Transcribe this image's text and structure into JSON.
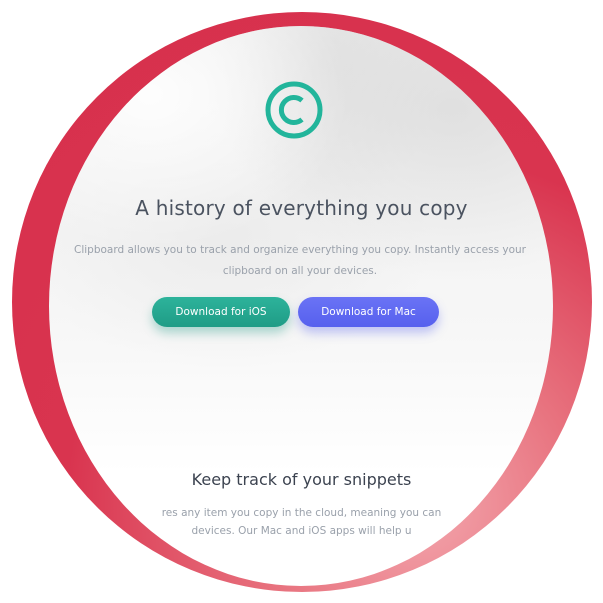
{
  "logo": {
    "icon": "copyright-c-icon",
    "color": "#22b59b"
  },
  "hero": {
    "headline": "A history of everything you copy",
    "subtext": "Clipboard allows you to track and organize everything you copy. Instantly access your clipboard on all your devices."
  },
  "buttons": {
    "ios_label": "Download for iOS",
    "mac_label": "Download for Mac",
    "ios_color": "#1f9c86",
    "mac_color": "#5660ee"
  },
  "features": {
    "title": "Keep track of your snippets",
    "body_line1": "res any item you copy in the cloud, meaning you can",
    "body_line2": "devices. Our Mac and iOS apps will help u"
  },
  "colors": {
    "decor_circle": "#d62f4c",
    "page_bg": "#ffffff"
  }
}
